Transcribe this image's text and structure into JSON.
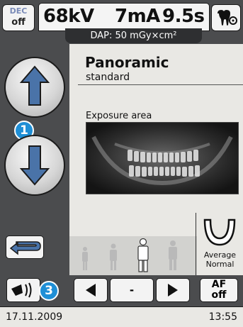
{
  "header": {
    "dec_top": "DEC",
    "dec_bottom": "off",
    "kv": "68kV",
    "ma": "7mA",
    "seconds": "9.5s",
    "dap": "DAP: 50 mGy×cm²",
    "symbol_icon": "tooth-settings-icon"
  },
  "program": {
    "title": "Panoramic",
    "subtitle": "standard"
  },
  "exposure": {
    "label": "Exposure area"
  },
  "badges": {
    "one": "1",
    "three": "3"
  },
  "jaw": {
    "line1": "Average",
    "line2": "Normal"
  },
  "controls": {
    "minus": "-",
    "af_top": "AF",
    "af_bottom": "off"
  },
  "footer": {
    "date": "17.11.2009",
    "time": "13:55"
  },
  "icons": {
    "up": "arrow-up-icon",
    "down": "arrow-down-icon",
    "return": "return-arrow-icon",
    "positioning": "positioning-light-icon",
    "left": "triangle-left-icon",
    "right": "triangle-right-icon",
    "jaw": "jaw-shape-icon"
  },
  "colors": {
    "badge": "#1f8fd6",
    "frame": "#4b4c4e",
    "panel": "#e9e8e4"
  }
}
